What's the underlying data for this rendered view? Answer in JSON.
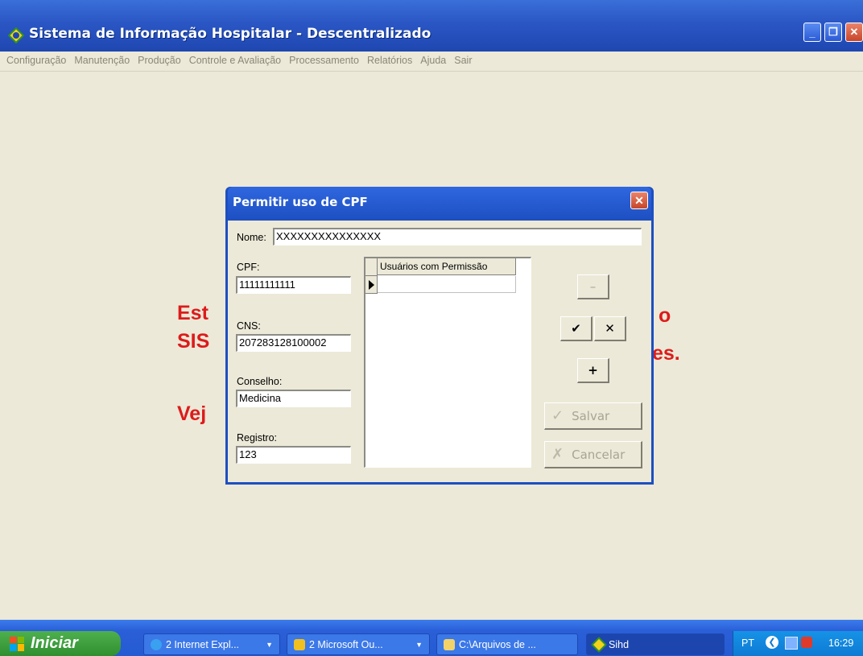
{
  "window": {
    "title": "Sistema de Informação Hospitalar - Descentralizado",
    "minimize_label": "_",
    "restore_label": "❐",
    "close_label": "✕"
  },
  "menu": {
    "items": [
      "Configuração",
      "Manutenção",
      "Produção",
      "Controle e Avaliação",
      "Processamento",
      "Relatórios",
      "Ajuda",
      "Sair"
    ]
  },
  "background": {
    "line1_left": "Est",
    "line1_right": "o",
    "line2_left": "SIS",
    "line2_right": "es.",
    "line3_left": "Vej"
  },
  "dialog": {
    "title": "Permitir uso de CPF",
    "close_label": "✕",
    "nome_label": "Nome:",
    "nome_value": "XXXXXXXXXXXXXXX",
    "cpf_label": "CPF:",
    "cpf_value": "11111111111",
    "cns_label": "CNS:",
    "cns_value": "207283128100002",
    "conselho_label": "Conselho:",
    "conselho_value": "Medicina",
    "registro_label": "Registro:",
    "registro_value": "123",
    "grid_header": "Usuários com Permissão",
    "btn_minus": "–",
    "btn_check": "✔",
    "btn_x": "✕",
    "btn_plus": "+",
    "btn_salvar": "Salvar",
    "btn_cancelar": "Cancelar",
    "icon_salvar": "✓",
    "icon_cancelar": "✗"
  },
  "taskbar": {
    "start_label": "Iniciar",
    "buttons": [
      {
        "label": "2 Internet Expl...",
        "arrow": "▼"
      },
      {
        "label": "2 Microsoft Ou...",
        "arrow": "▼"
      },
      {
        "label": "C:\\Arquivos de ..."
      },
      {
        "label": "Sihd"
      }
    ],
    "lang": "PT",
    "clock": "16:29"
  }
}
